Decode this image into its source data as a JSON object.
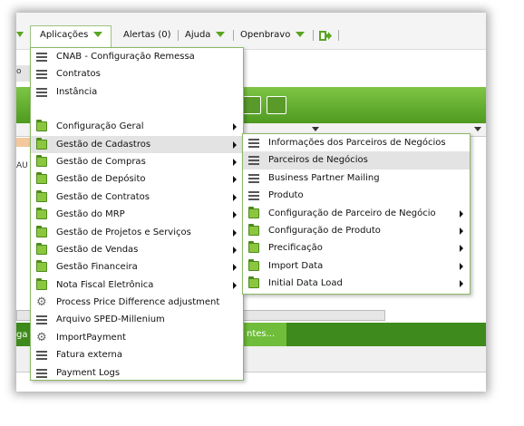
{
  "topbar": {
    "applications": "Aplicações",
    "alerts": "Alertas (0)",
    "help": "Ajuda",
    "openbravo": "Openbravo"
  },
  "background": {
    "partial_label_1": "o",
    "partial_label_2": "AU",
    "partial_label_3": "ga",
    "bottom_tab": "ntes..."
  },
  "main_menu": {
    "items": [
      {
        "label": "CNAB - Configuração Remessa",
        "icon": "list-icon"
      },
      {
        "label": "Contratos",
        "icon": "list-icon"
      },
      {
        "label": "Instância",
        "icon": "list-icon"
      },
      {
        "label": "Configuração Geral",
        "icon": "folder-icon",
        "submenu": true
      },
      {
        "label": "Gestão de Cadastros",
        "icon": "folder-icon",
        "submenu": true
      },
      {
        "label": "Gestão de Compras",
        "icon": "folder-icon",
        "submenu": true
      },
      {
        "label": "Gestão de Depósito",
        "icon": "folder-icon",
        "submenu": true
      },
      {
        "label": "Gestão de Contratos",
        "icon": "folder-icon",
        "submenu": true
      },
      {
        "label": "Gestão do MRP",
        "icon": "folder-icon",
        "submenu": true
      },
      {
        "label": "Gestão de Projetos e Serviços",
        "icon": "folder-icon",
        "submenu": true
      },
      {
        "label": "Gestão de Vendas",
        "icon": "folder-icon",
        "submenu": true
      },
      {
        "label": "Gestão Financeira",
        "icon": "folder-icon",
        "submenu": true
      },
      {
        "label": "Nota Fiscal Eletrônica",
        "icon": "folder-icon",
        "submenu": true
      },
      {
        "label": "Process Price Difference adjustment",
        "icon": "gear-icon"
      },
      {
        "label": "Arquivo SPED-Millenium",
        "icon": "list-icon"
      },
      {
        "label": "ImportPayment",
        "icon": "gear-icon"
      },
      {
        "label": "Fatura externa",
        "icon": "list-icon"
      },
      {
        "label": "Payment Logs",
        "icon": "list-icon"
      }
    ]
  },
  "sub_menu": {
    "items": [
      {
        "label": "Informações dos Parceiros de Negócios",
        "icon": "list-icon"
      },
      {
        "label": "Parceiros de Negócios",
        "icon": "list-icon"
      },
      {
        "label": "Business Partner Mailing",
        "icon": "list-icon"
      },
      {
        "label": "Produto",
        "icon": "list-icon"
      },
      {
        "label": "Configuração de Parceiro de Negócio",
        "icon": "folder-icon",
        "submenu": true
      },
      {
        "label": "Configuração de Produto",
        "icon": "folder-icon",
        "submenu": true
      },
      {
        "label": "Precificação",
        "icon": "folder-icon",
        "submenu": true
      },
      {
        "label": "Import Data",
        "icon": "folder-icon",
        "submenu": true
      },
      {
        "label": "Initial Data Load",
        "icon": "folder-icon",
        "submenu": true
      }
    ]
  },
  "colors": {
    "accent_green": "#5aa520",
    "menu_border": "#8ab866",
    "highlight": "#e3e3e3"
  }
}
